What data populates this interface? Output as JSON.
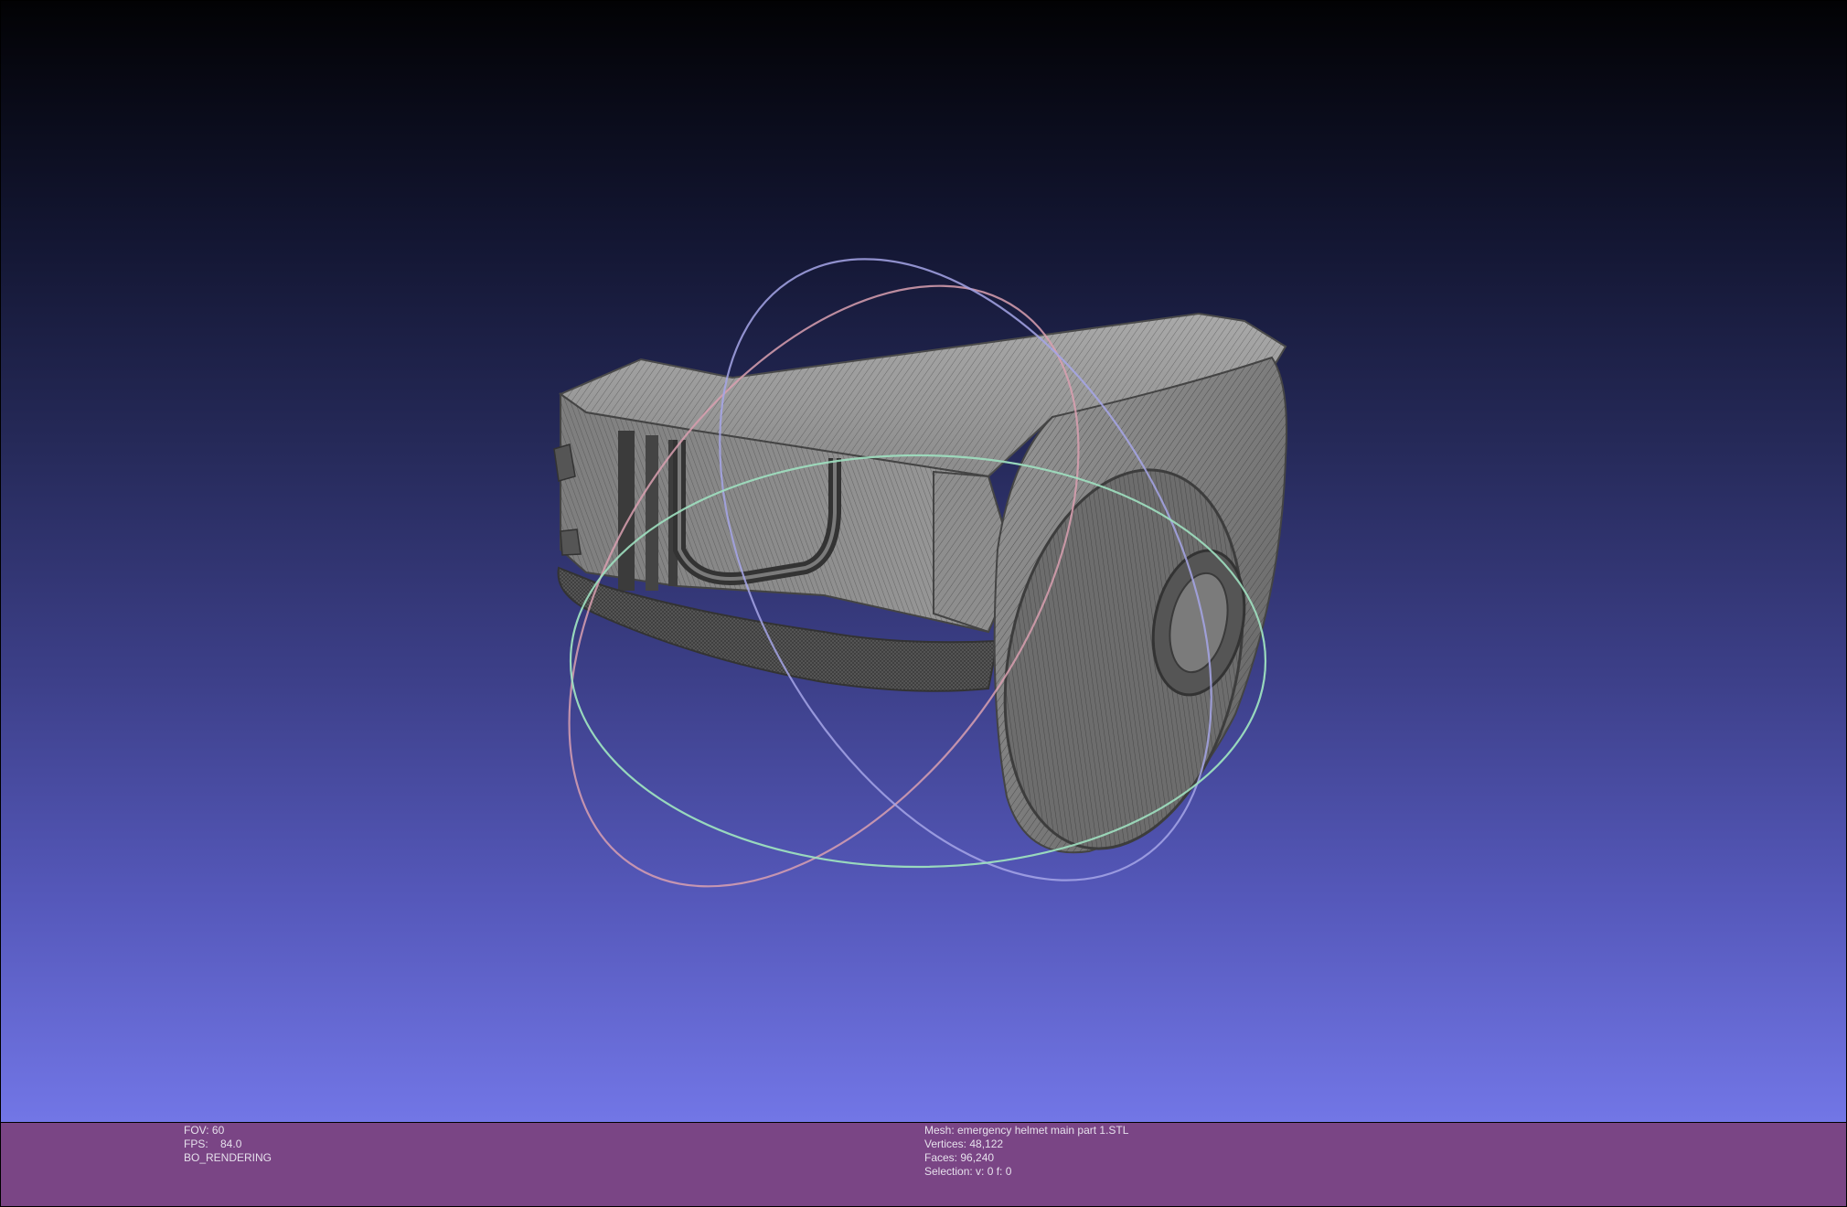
{
  "viewer": {
    "background_top": "#020204",
    "background_bottom": "#7276e6",
    "info_bar_color": "#7a4585",
    "mesh_color": "#9a9a9a",
    "wire_color": "#3a3a3a"
  },
  "info_left": {
    "fov": "FOV: 60",
    "fps": "FPS:    84.0",
    "mode": "BO_RENDERING"
  },
  "info_right": {
    "mesh": "Mesh: emergency helmet main part 1.STL",
    "vertices": "Vertices: 48,122",
    "faces": "Faces: 96,240",
    "selection": "Selection: v: 0 f: 0"
  },
  "trackball": {
    "rings": [
      "red",
      "green",
      "blue"
    ]
  }
}
